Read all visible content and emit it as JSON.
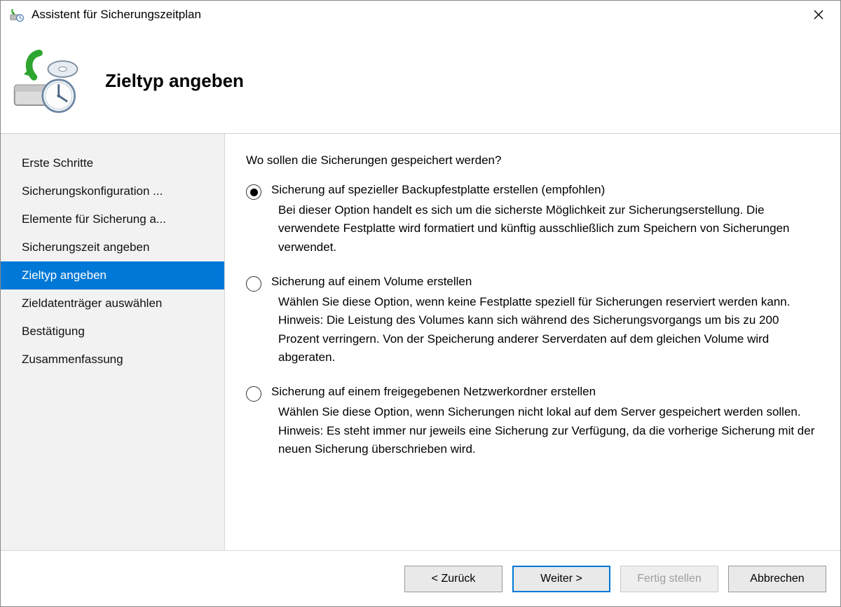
{
  "window": {
    "title": "Assistent für Sicherungszeitplan"
  },
  "header": {
    "title": "Zieltyp angeben"
  },
  "sidebar": {
    "items": [
      {
        "label": "Erste Schritte",
        "selected": false
      },
      {
        "label": "Sicherungskonfiguration ...",
        "selected": false
      },
      {
        "label": "Elemente für Sicherung a...",
        "selected": false
      },
      {
        "label": "Sicherungszeit angeben",
        "selected": false
      },
      {
        "label": "Zieltyp angeben",
        "selected": true
      },
      {
        "label": "Zieldatenträger auswählen",
        "selected": false
      },
      {
        "label": "Bestätigung",
        "selected": false
      },
      {
        "label": "Zusammenfassung",
        "selected": false
      }
    ]
  },
  "content": {
    "question": "Wo sollen die Sicherungen gespeichert werden?",
    "options": [
      {
        "label": "Sicherung auf spezieller Backupfestplatte erstellen (empfohlen)",
        "description": "Bei dieser Option handelt es sich um die sicherste Möglichkeit zur Sicherungserstellung. Die verwendete Festplatte wird formatiert und künftig ausschließlich zum Speichern von Sicherungen verwendet.",
        "selected": true
      },
      {
        "label": "Sicherung auf einem Volume erstellen",
        "description": "Wählen Sie diese Option, wenn keine Festplatte speziell für Sicherungen reserviert werden kann. Hinweis: Die Leistung des Volumes kann sich während des Sicherungsvorgangs um bis zu 200 Prozent verringern. Von der Speicherung anderer Serverdaten auf dem gleichen Volume wird abgeraten.",
        "selected": false
      },
      {
        "label": "Sicherung auf einem freigegebenen Netzwerkordner erstellen",
        "description": "Wählen Sie diese Option, wenn Sicherungen nicht lokal auf dem Server gespeichert werden sollen. Hinweis: Es steht immer nur jeweils eine Sicherung zur Verfügung, da die vorherige Sicherung mit der neuen Sicherung überschrieben wird.",
        "selected": false
      }
    ]
  },
  "footer": {
    "back": "< Zurück",
    "next": "Weiter >",
    "finish": "Fertig stellen",
    "cancel": "Abbrechen"
  }
}
